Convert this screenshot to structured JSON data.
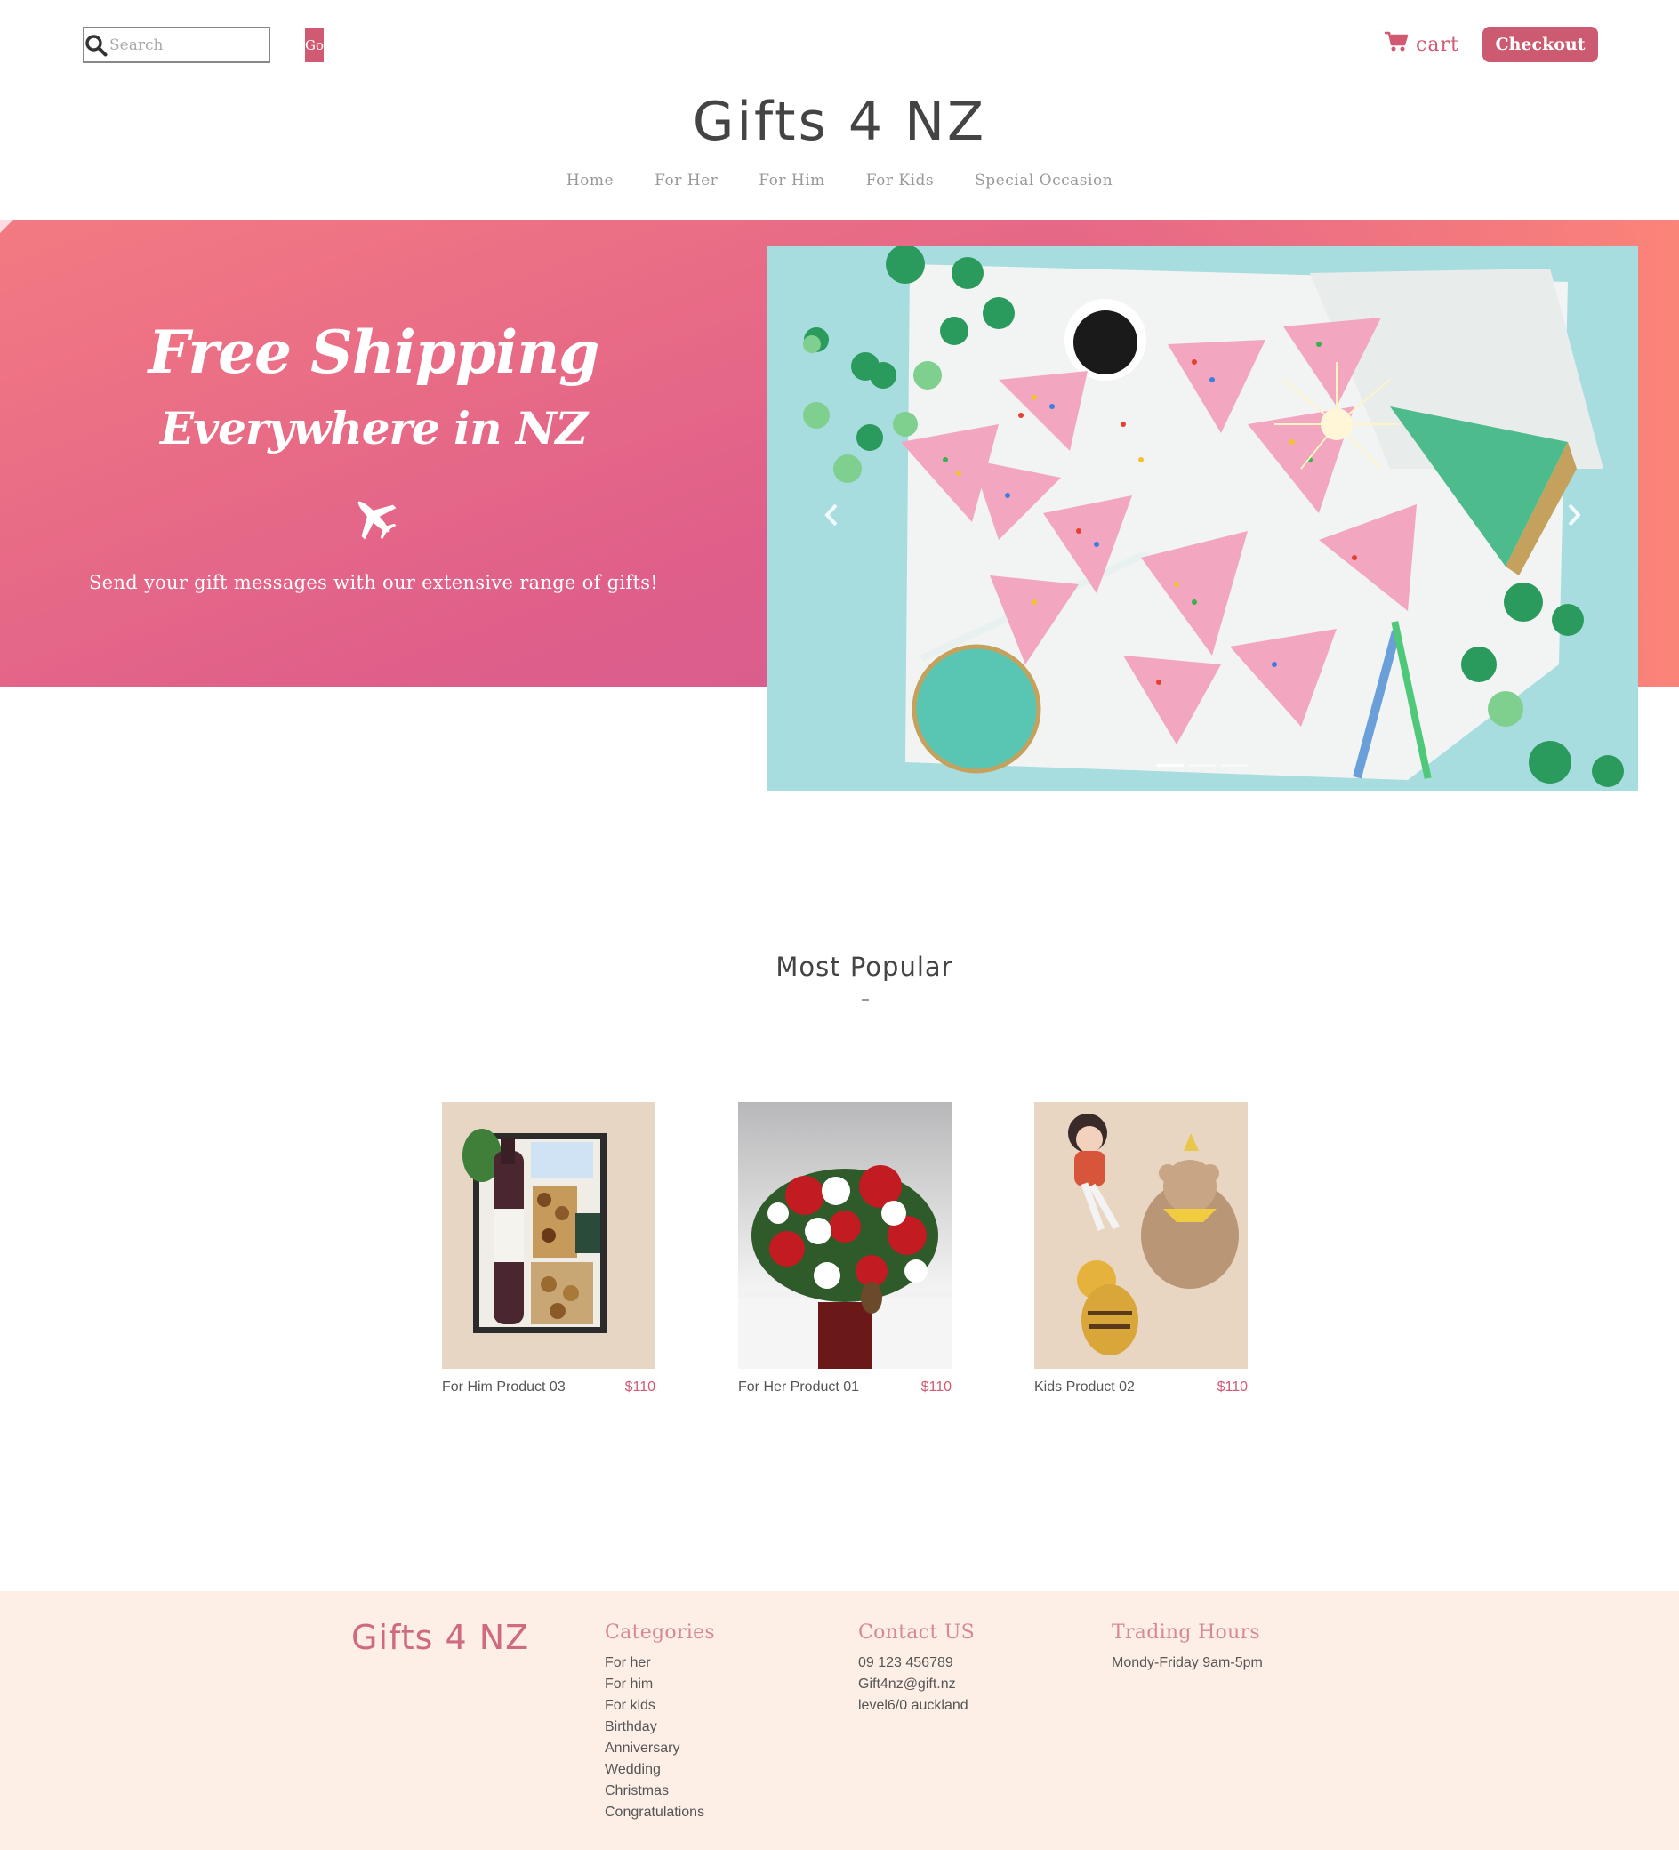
{
  "header": {
    "search_placeholder": "Search",
    "go_label": "Go",
    "cart_label": "cart",
    "checkout_label": "Checkout",
    "logo": "Gifts 4 NZ"
  },
  "nav": {
    "items": [
      "Home",
      "For Her",
      "For Him",
      "For Kids",
      "Special Occasion"
    ]
  },
  "hero": {
    "title_line1": "Free Shipping",
    "title_line2": "Everywhere in NZ",
    "icon": "airplane-icon",
    "subtitle": "Send your gift messages with our extensive range of gifts!"
  },
  "carousel": {
    "slide_count": 3,
    "active_index": 0
  },
  "popular": {
    "title": "Most Popular",
    "products": [
      {
        "name": "For Him Product 03",
        "price": "$110"
      },
      {
        "name": "For Her Product 01",
        "price": "$110"
      },
      {
        "name": "Kids Product 02",
        "price": "$110"
      }
    ]
  },
  "footer": {
    "logo": "Gifts 4 NZ",
    "categories": {
      "heading": "Categories",
      "items": [
        "For her",
        "For him",
        "For kids",
        "Birthday",
        "Anniversary",
        "Wedding",
        "Christmas",
        "Congratulations"
      ]
    },
    "contact": {
      "heading": "Contact US",
      "phone": "09 123 456789",
      "email": "Gift4nz@gift.nz",
      "address": "level6/0 auckland"
    },
    "hours": {
      "heading": "Trading Hours",
      "text": "Mondy-Friday 9am-5pm"
    }
  },
  "colors": {
    "accent": "#d05a72",
    "hero_start": "#f37a82",
    "hero_end": "#cf5a93",
    "footer_bg": "#fdeee6"
  }
}
